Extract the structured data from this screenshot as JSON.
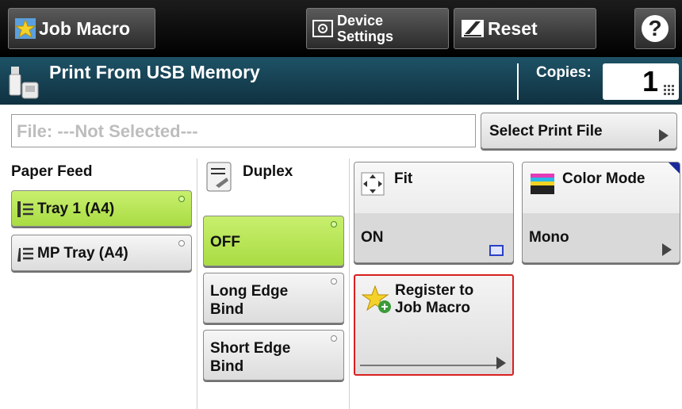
{
  "toolbar": {
    "job_macro": "Job Macro",
    "device_settings_line1": "Device",
    "device_settings_line2": "Settings",
    "reset": "Reset",
    "help": "?"
  },
  "header": {
    "title": "Print From USB Memory",
    "copies_label": "Copies:",
    "copies_value": "1"
  },
  "file": {
    "status": "File: ---Not Selected---",
    "select_button": "Select Print File"
  },
  "paper_feed": {
    "label": "Paper Feed",
    "options": [
      {
        "label": "Tray 1 (A4)",
        "selected": true
      },
      {
        "label": "MP Tray (A4)",
        "selected": false
      }
    ]
  },
  "duplex": {
    "label": "Duplex",
    "options": [
      {
        "label": "OFF",
        "selected": true
      },
      {
        "label_line1": "Long Edge",
        "label_line2": "Bind",
        "selected": false
      },
      {
        "label_line1": "Short Edge",
        "label_line2": "Bind",
        "selected": false
      }
    ]
  },
  "fit": {
    "label": "Fit",
    "value": "ON"
  },
  "color_mode": {
    "label": "Color Mode",
    "value": "Mono"
  },
  "register_macro": {
    "line1": "Register to",
    "line2": "Job Macro"
  },
  "colors": {
    "selected_green": "#b6e35a",
    "title_bar": "#174a5c",
    "highlight_red": "#d82020",
    "indicator_blue": "#1a2a9a"
  }
}
